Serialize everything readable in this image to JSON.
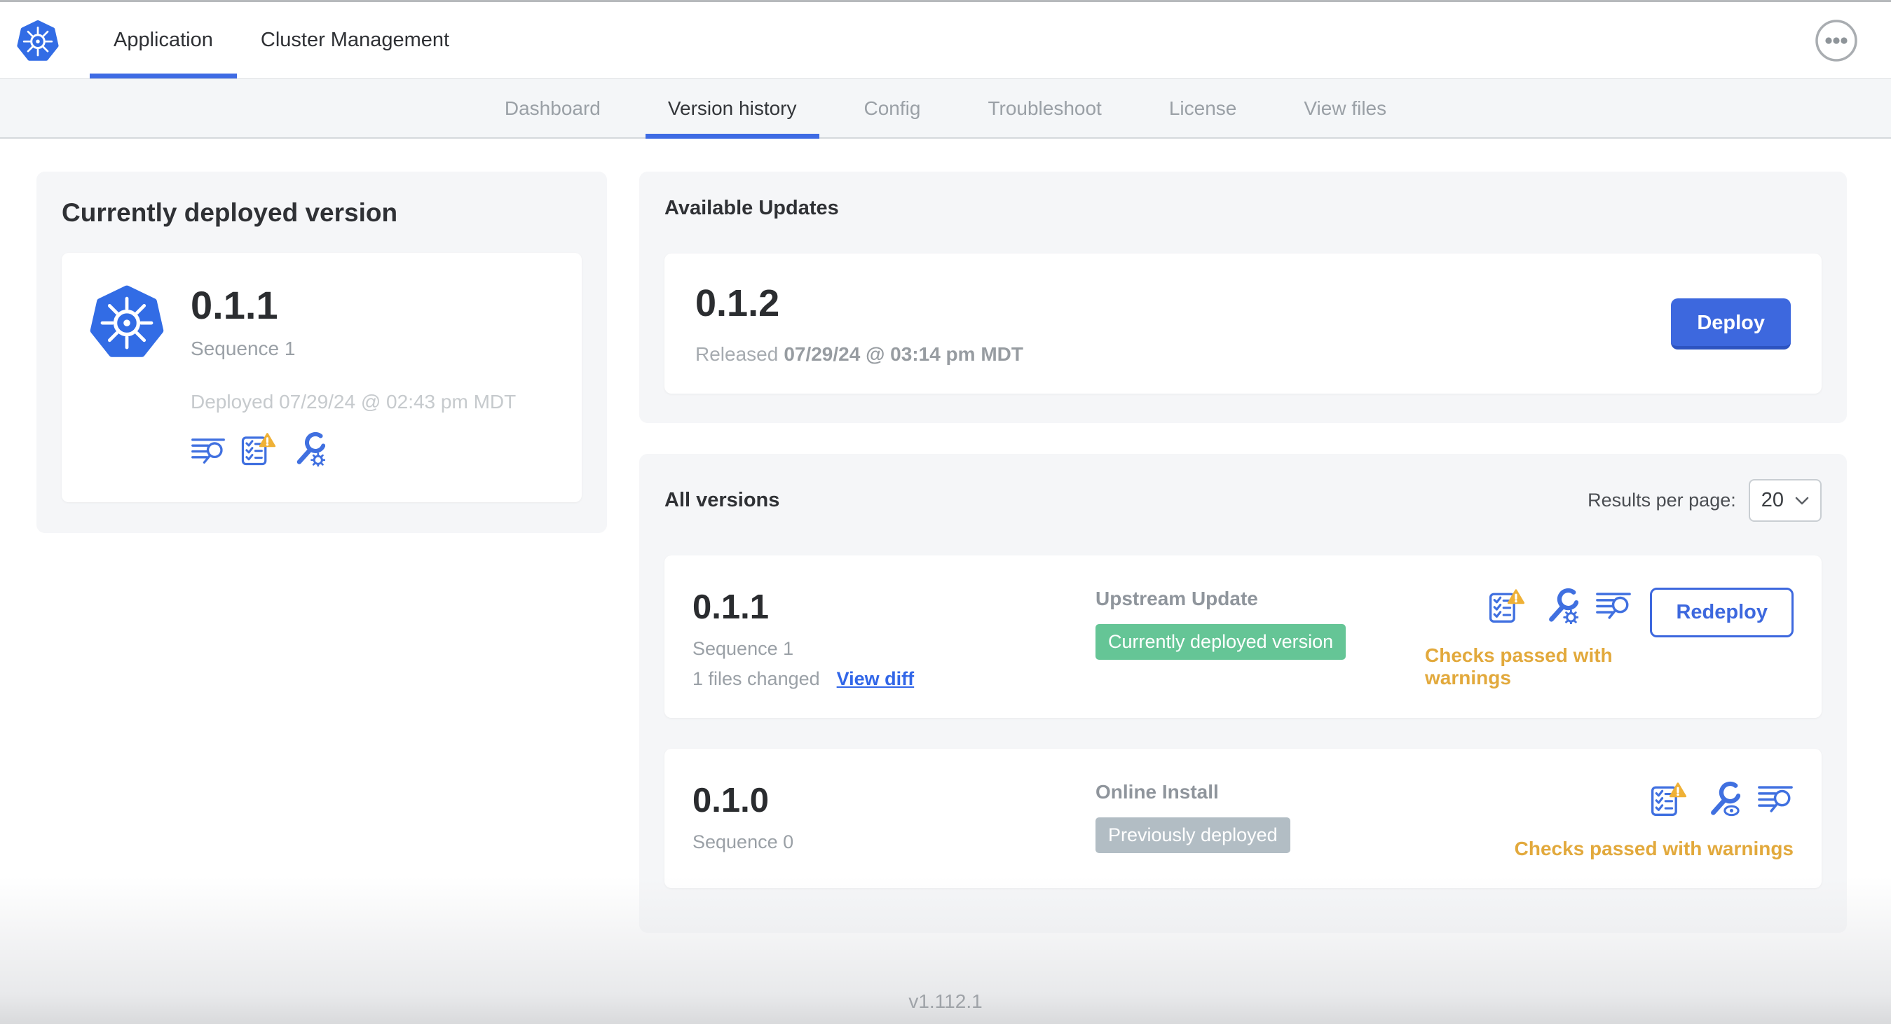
{
  "header": {
    "brand_icon": "kubernetes-logo",
    "tabs": [
      {
        "label": "Application",
        "active": true
      },
      {
        "label": "Cluster Management",
        "active": false
      }
    ],
    "overflow_menu_icon": "ellipsis-menu"
  },
  "nav": {
    "tabs": [
      {
        "label": "Dashboard",
        "active": false
      },
      {
        "label": "Version history",
        "active": true
      },
      {
        "label": "Config",
        "active": false
      },
      {
        "label": "Troubleshoot",
        "active": false
      },
      {
        "label": "License",
        "active": false
      },
      {
        "label": "View files",
        "active": false
      }
    ]
  },
  "deployed_card": {
    "title": "Currently deployed version",
    "version": "0.1.1",
    "sequence": "Sequence 1",
    "deployed_at": "Deployed 07/29/24 @ 02:43 pm MDT",
    "icons": [
      "deploy-logs-icon",
      "preflight-checks-warning-icon",
      "edit-config-icon"
    ]
  },
  "available_updates": {
    "title": "Available Updates",
    "version": "0.1.2",
    "released_prefix": "Released",
    "released_datetime": "07/29/24 @ 03:14 pm MDT",
    "deploy_label": "Deploy"
  },
  "all_versions": {
    "title": "All versions",
    "results_per_page_label": "Results per page:",
    "results_per_page_value": "20",
    "rows": [
      {
        "version": "0.1.1",
        "sequence": "Sequence 1",
        "files_changed": "1 files changed",
        "view_diff_label": "View diff",
        "source": "Upstream Update",
        "badge_label": "Currently deployed version",
        "badge_color": "#65c596",
        "action_label": "Redeploy",
        "status": "Checks passed with warnings",
        "icons": [
          "preflight-checks-warning-icon",
          "edit-config-icon",
          "deploy-logs-icon"
        ]
      },
      {
        "version": "0.1.0",
        "sequence": "Sequence 0",
        "source": "Online Install",
        "badge_label": "Previously deployed",
        "badge_color": "#b2bdc4",
        "status": "Checks passed with warnings",
        "icons": [
          "preflight-checks-warning-icon",
          "view-config-icon",
          "deploy-logs-icon"
        ]
      }
    ]
  },
  "footer": {
    "app_version": "v1.112.1"
  },
  "colors": {
    "accent_blue": "#3e6be4",
    "kubernetes_blue": "#326ce5",
    "badge_green": "#65c596",
    "badge_gray": "#b2bdc4",
    "warning_amber": "#e2a93c",
    "link_blue": "#3166e8"
  }
}
